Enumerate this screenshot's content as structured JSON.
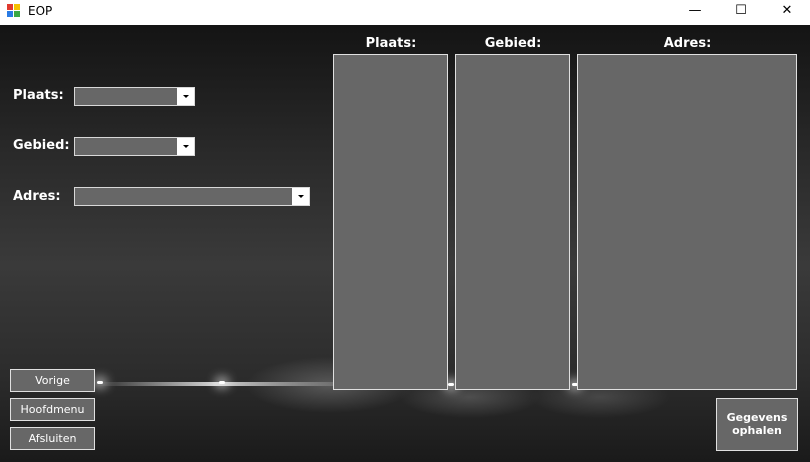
{
  "window": {
    "title": "EOP",
    "minimize_glyph": "—",
    "maximize_glyph": "☐",
    "close_glyph": "✕"
  },
  "filters": {
    "plaats_label": "Plaats:",
    "plaats_value": "",
    "gebied_label": "Gebied:",
    "gebied_value": "",
    "adres_label": "Adres:",
    "adres_value": ""
  },
  "columns": {
    "plaats_header": "Plaats:",
    "gebied_header": "Gebied:",
    "adres_header": "Adres:"
  },
  "buttons": {
    "vorige": "Vorige",
    "hoofdmenu": "Hoofdmenu",
    "afsluiten": "Afsluiten",
    "gegevens_line1": "Gegevens",
    "gegevens_line2": "ophalen"
  },
  "colors": {
    "control_bg": "#676767",
    "control_border": "#e0e0e0",
    "text": "#ffffff"
  }
}
